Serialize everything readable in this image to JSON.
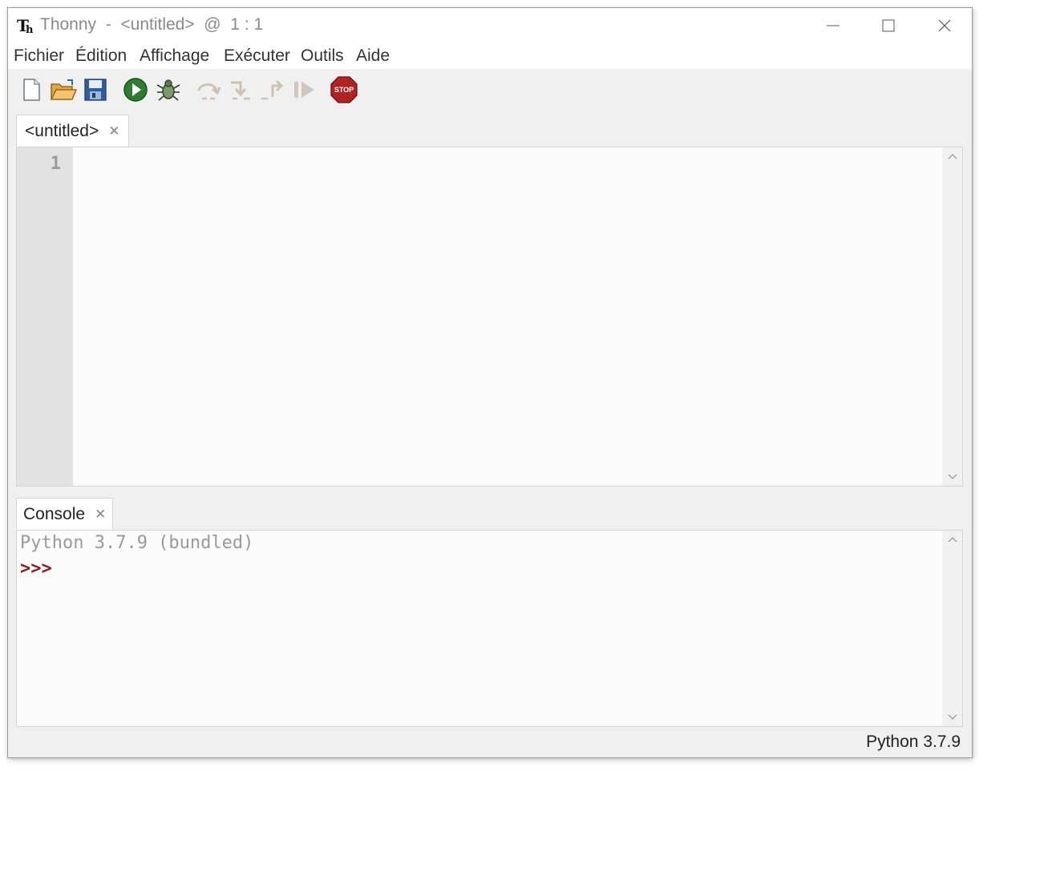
{
  "window": {
    "app_name": "Thonny",
    "title": "Thonny  -  <untitled>  @  1 : 1"
  },
  "menu": {
    "items": [
      "Fichier",
      "Édition",
      "Affichage",
      "Exécuter",
      "Outils",
      "Aide"
    ]
  },
  "toolbar": {
    "buttons": [
      {
        "icon": "new-file-icon",
        "enabled": true
      },
      {
        "icon": "open-folder-icon",
        "enabled": true
      },
      {
        "icon": "save-icon",
        "enabled": true
      },
      {
        "icon": "run-icon",
        "enabled": true
      },
      {
        "icon": "debug-bug-icon",
        "enabled": true
      },
      {
        "icon": "step-over-icon",
        "enabled": false
      },
      {
        "icon": "step-into-icon",
        "enabled": false
      },
      {
        "icon": "step-out-icon",
        "enabled": false
      },
      {
        "icon": "resume-icon",
        "enabled": false
      },
      {
        "icon": "stop-icon",
        "enabled": true,
        "label": "STOP"
      }
    ]
  },
  "editor": {
    "tab_label": "<untitled>",
    "line_numbers": [
      "1"
    ]
  },
  "console": {
    "tab_label": "Console",
    "banner": "Python 3.7.9 (bundled)",
    "prompt": ">>>"
  },
  "statusbar": {
    "interpreter": "Python 3.7.9"
  },
  "colors": {
    "run_green": "#2e7d32",
    "stop_red": "#b22222",
    "prompt_red": "#8b1a1a",
    "gutter_bg": "#e2e2e2"
  }
}
